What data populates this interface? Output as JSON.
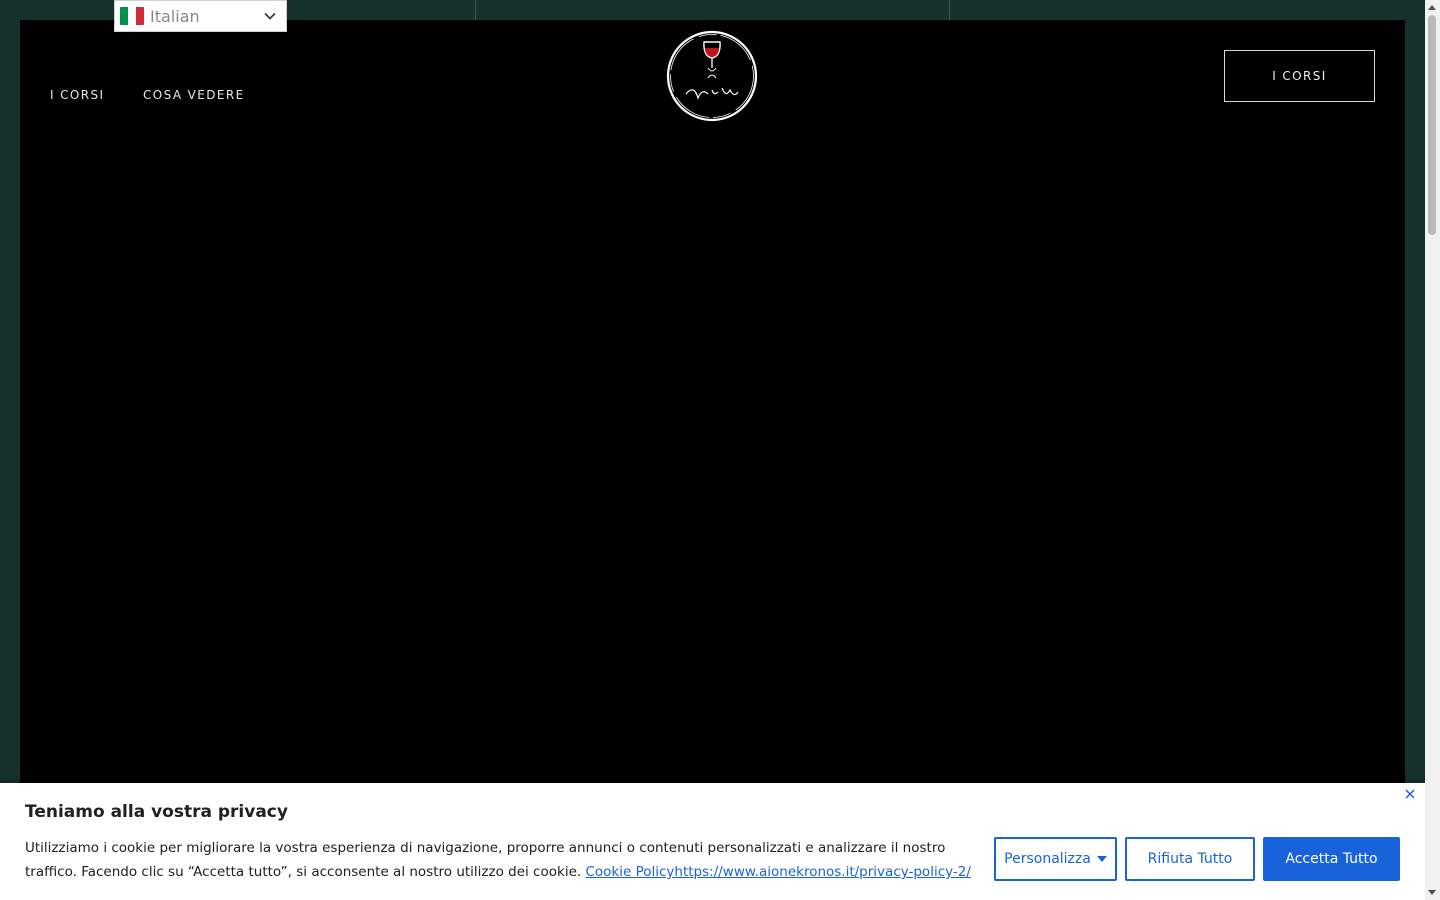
{
  "language_selector": {
    "selected": "Italian",
    "flag_colors": [
      "#009246",
      "#ffffff",
      "#ce2b37"
    ]
  },
  "nav": {
    "links": [
      {
        "label": "I CORSI"
      },
      {
        "label": "COSA VEDERE"
      }
    ],
    "cta_label": "I CORSI"
  },
  "logo": {
    "alt_text": "Aion e Kronos",
    "accent_color": "#c0141c"
  },
  "cookie_banner": {
    "title": "Teniamo alla vostra privacy",
    "text": "Utilizziamo i cookie per migliorare la vostra esperienza di navigazione, proporre annunci o contenuti personalizzati e analizzare il nostro traffico. Facendo clic su “Accetta tutto”, si acconsente al nostro utilizzo dei cookie.",
    "link_label": "Cookie Policyhttps://www.aionekronos.it/privacy-policy-2/",
    "buttons": {
      "customize": "Personalizza",
      "reject": "Rifiuta Tutto",
      "accept": "Accetta Tutto"
    },
    "accent_color": "#1863dc"
  },
  "colors": {
    "page_background": "#16302e",
    "hero_background": "#000000"
  }
}
